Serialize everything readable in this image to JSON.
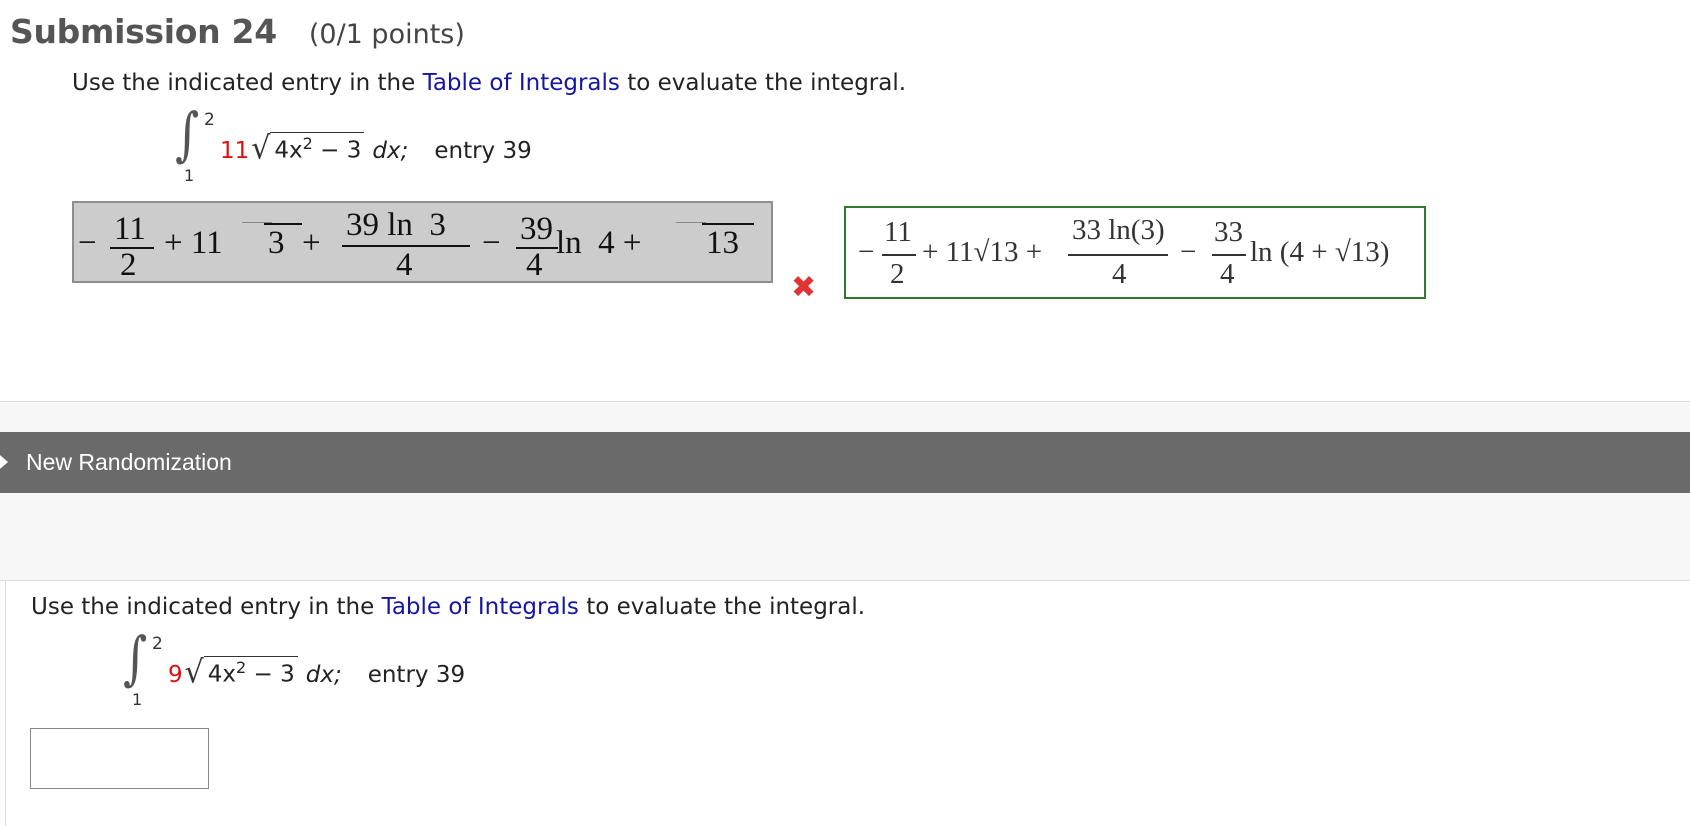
{
  "submission": {
    "title": "Submission 24",
    "points": "(0/1 points)"
  },
  "question1": {
    "prefix": "Use the indicated entry in the ",
    "link": "Table of Integrals",
    "suffix": " to evaluate the integral.",
    "upper": "2",
    "lower": "1",
    "coef": "11",
    "radicand_base": "4x",
    "radicand_exp": "2",
    "radicand_tail": " − 3",
    "dx": "dx;",
    "entry": "entry 39"
  },
  "submitted_answer": {
    "minus1": "−",
    "f1_num": "11",
    "f1_den": "2",
    "term2": "+ 11",
    "sqrt_arg1": "3",
    "plus1": "+",
    "f2_num": "39 ln  3",
    "f2_den": "4",
    "minus2": "−",
    "f3_num": "39",
    "f3_den": "4",
    "ln_part": "ln  4 +",
    "sqrt_arg2": "13"
  },
  "status": {
    "icon": "wrong-x-icon",
    "symbol": "✖",
    "color": "#e03333"
  },
  "correct_answer": {
    "minus1": "−",
    "f1_num": "11",
    "f1_den": "2",
    "term2": "+ 11√13 +",
    "f2_num": "33 ln(3)",
    "f2_den": "4",
    "minus2": "−",
    "f3_num": "33",
    "f3_den": "4",
    "ln_part": "ln (4 + √13)"
  },
  "randomization": {
    "label": "New Randomization"
  },
  "question2": {
    "prefix": "Use the indicated entry in the ",
    "link": "Table of Integrals",
    "suffix": " to evaluate the integral.",
    "upper": "2",
    "lower": "1",
    "coef": "9",
    "radicand_base": "4x",
    "radicand_exp": "2",
    "radicand_tail": " − 3",
    "dx": "dx;",
    "entry": "entry 39",
    "answer_value": ""
  }
}
